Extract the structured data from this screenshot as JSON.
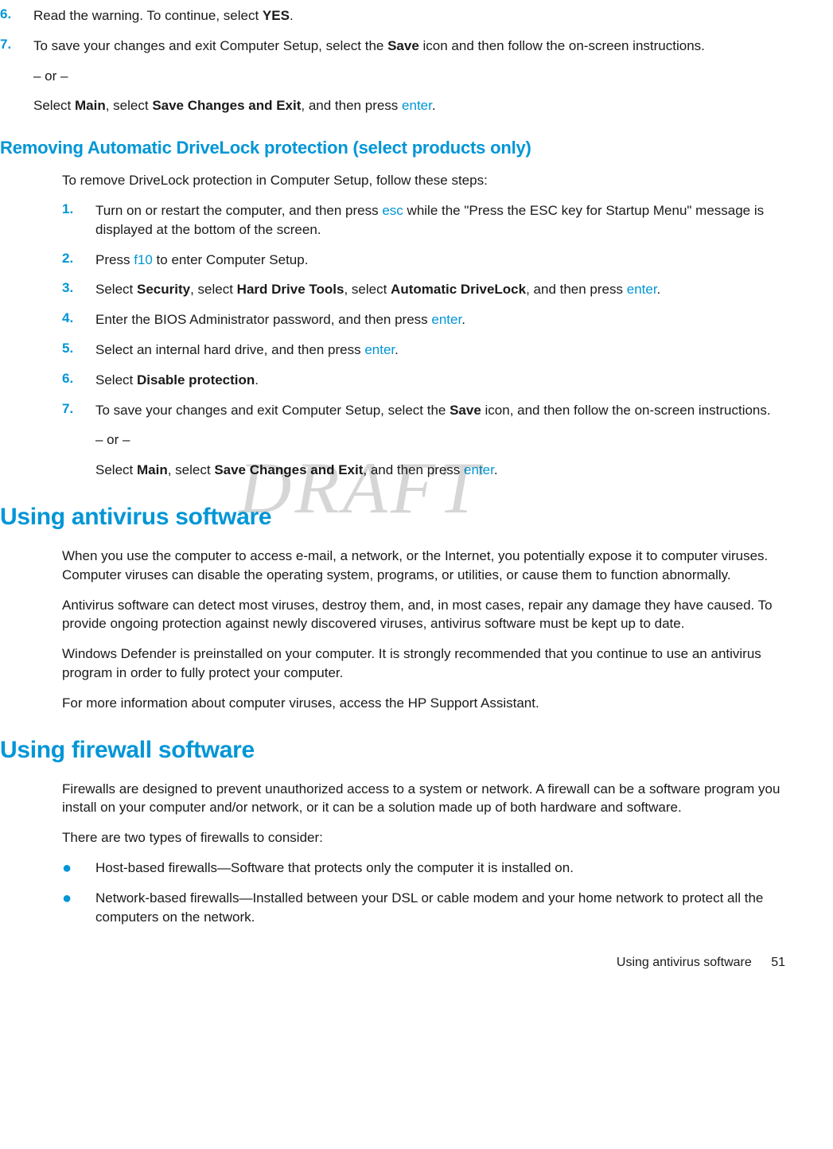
{
  "watermark": "DRAFT",
  "top_continued": {
    "item6": {
      "num": "6.",
      "parts": [
        {
          "t": "Read the warning. To continue, select "
        },
        {
          "t": "YES",
          "b": true
        },
        {
          "t": "."
        }
      ]
    },
    "item7": {
      "num": "7.",
      "line1": [
        {
          "t": "To save your changes and exit Computer Setup, select the "
        },
        {
          "t": "Save",
          "b": true
        },
        {
          "t": " icon and then follow the on-screen instructions."
        }
      ],
      "or": "– or –",
      "line2": [
        {
          "t": "Select "
        },
        {
          "t": "Main",
          "b": true
        },
        {
          "t": ", select "
        },
        {
          "t": "Save Changes and Exit",
          "b": true
        },
        {
          "t": ", and then press "
        },
        {
          "t": "enter",
          "k": true
        },
        {
          "t": "."
        }
      ]
    }
  },
  "section_removing": {
    "heading": "Removing Automatic DriveLock protection (select products only)",
    "intro": "To remove DriveLock protection in Computer Setup, follow these steps:",
    "steps": [
      {
        "num": "1.",
        "paras": [
          [
            {
              "t": "Turn on or restart the computer, and then press "
            },
            {
              "t": "esc",
              "k": true
            },
            {
              "t": " while the \"Press the ESC key for Startup Menu\" message is displayed at the bottom of the screen."
            }
          ]
        ]
      },
      {
        "num": "2.",
        "paras": [
          [
            {
              "t": "Press "
            },
            {
              "t": "f10",
              "k": true
            },
            {
              "t": " to enter Computer Setup."
            }
          ]
        ]
      },
      {
        "num": "3.",
        "paras": [
          [
            {
              "t": "Select "
            },
            {
              "t": "Security",
              "b": true
            },
            {
              "t": ", select "
            },
            {
              "t": "Hard Drive Tools",
              "b": true
            },
            {
              "t": ", select "
            },
            {
              "t": "Automatic DriveLock",
              "b": true
            },
            {
              "t": ", and then press "
            },
            {
              "t": "enter",
              "k": true
            },
            {
              "t": "."
            }
          ]
        ]
      },
      {
        "num": "4.",
        "paras": [
          [
            {
              "t": "Enter the BIOS Administrator password, and then press "
            },
            {
              "t": "enter",
              "k": true
            },
            {
              "t": "."
            }
          ]
        ]
      },
      {
        "num": "5.",
        "paras": [
          [
            {
              "t": "Select an internal hard drive, and then press "
            },
            {
              "t": "enter",
              "k": true
            },
            {
              "t": "."
            }
          ]
        ]
      },
      {
        "num": "6.",
        "paras": [
          [
            {
              "t": "Select "
            },
            {
              "t": "Disable protection",
              "b": true
            },
            {
              "t": "."
            }
          ]
        ]
      },
      {
        "num": "7.",
        "paras": [
          [
            {
              "t": "To save your changes and exit Computer Setup, select the "
            },
            {
              "t": "Save",
              "b": true
            },
            {
              "t": " icon, and then follow the on-screen instructions."
            }
          ]
        ],
        "or": "– or –",
        "extra": [
          [
            {
              "t": "Select "
            },
            {
              "t": "Main",
              "b": true
            },
            {
              "t": ", select "
            },
            {
              "t": "Save Changes and Exit",
              "b": true
            },
            {
              "t": ", and then press "
            },
            {
              "t": "enter",
              "k": true
            },
            {
              "t": "."
            }
          ]
        ]
      }
    ]
  },
  "section_antivirus": {
    "heading": "Using antivirus software",
    "paras": [
      "When you use the computer to access e-mail, a network, or the Internet, you potentially expose it to computer viruses. Computer viruses can disable the operating system, programs, or utilities, or cause them to function abnormally.",
      "Antivirus software can detect most viruses, destroy them, and, in most cases, repair any damage they have caused. To provide ongoing protection against newly discovered viruses, antivirus software must be kept up to date.",
      "Windows Defender is preinstalled on your computer. It is strongly recommended that you continue to use an antivirus program in order to fully protect your computer.",
      "For more information about computer viruses, access the HP Support Assistant."
    ]
  },
  "section_firewall": {
    "heading": "Using firewall software",
    "paras": [
      "Firewalls are designed to prevent unauthorized access to a system or network. A firewall can be a software program you install on your computer and/or network, or it can be a solution made up of both hardware and software.",
      "There are two types of firewalls to consider:"
    ],
    "bullets": [
      "Host-based firewalls—Software that protects only the computer it is installed on.",
      "Network-based firewalls—Installed between your DSL or cable modem and your home network to protect all the computers on the network."
    ]
  },
  "footer": {
    "title": "Using antivirus software",
    "page": "51"
  }
}
